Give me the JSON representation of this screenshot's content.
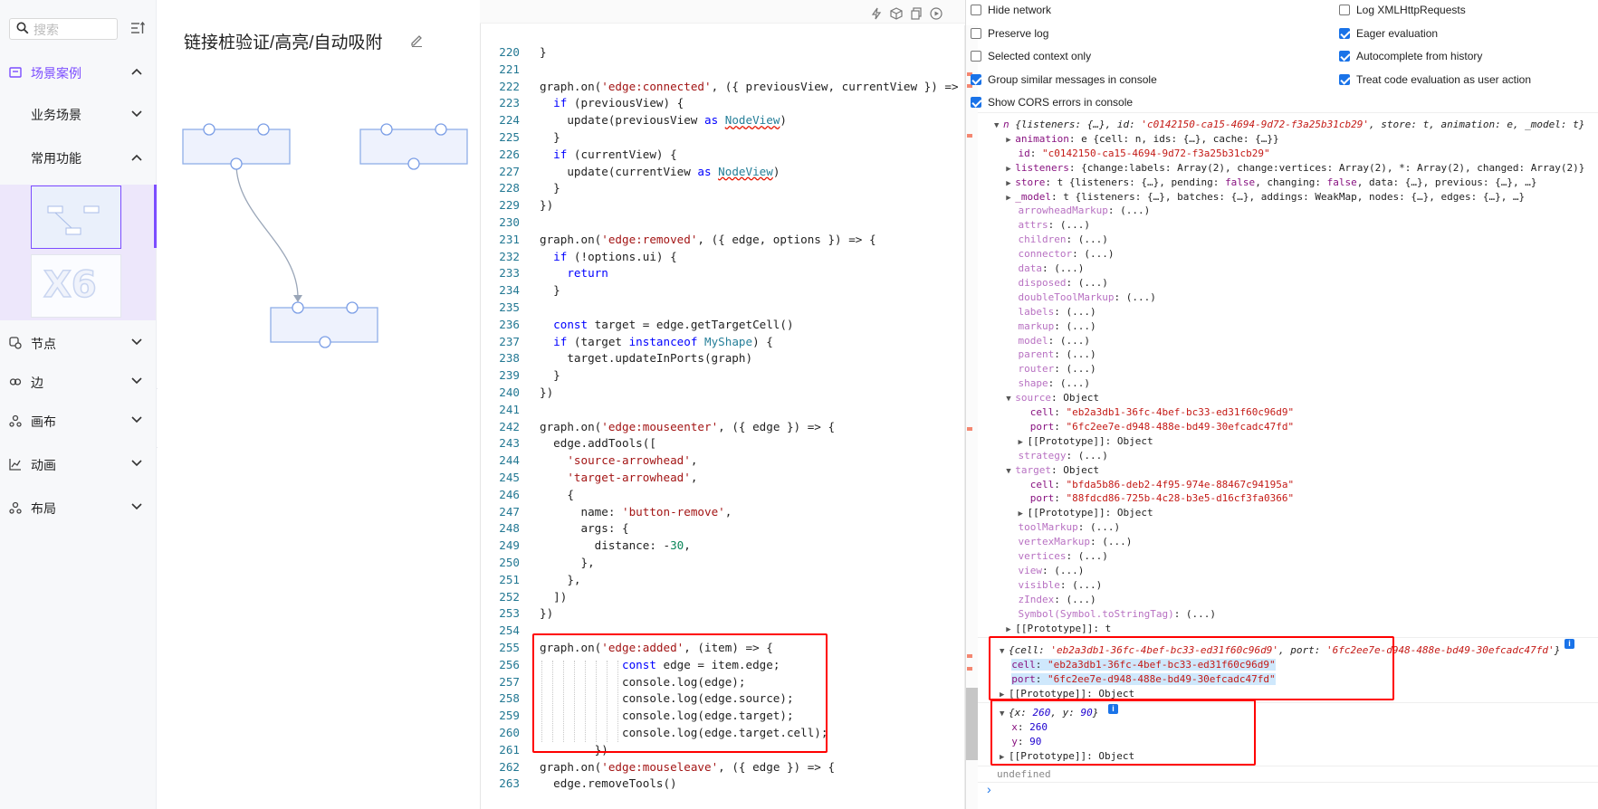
{
  "sidebar": {
    "search_placeholder": "搜索",
    "sections": [
      {
        "label": "场景案例",
        "active": true
      },
      {
        "label": "节点"
      },
      {
        "label": "边"
      },
      {
        "label": "画布"
      },
      {
        "label": "动画"
      },
      {
        "label": "布局"
      }
    ],
    "subsections": [
      {
        "label": "业务场景"
      },
      {
        "label": "常用功能",
        "active": true
      }
    ],
    "thumb2_text": "X6"
  },
  "preview": {
    "title": "链接桩验证/高亮/自动吸附"
  },
  "editor": {
    "lines": [
      {
        "n": "220",
        "html": "}"
      },
      {
        "n": "221",
        "html": ""
      },
      {
        "n": "222",
        "html": "graph.on(<span class='s'>'edge:connected'</span>, ({ previousView, currentView }) =>"
      },
      {
        "n": "223",
        "html": "  <span class='k'>if</span> (previousView) {"
      },
      {
        "n": "224",
        "html": "    update(previousView <span class='k'>as</span> <span class='t u'>NodeView</span>)"
      },
      {
        "n": "225",
        "html": "  }"
      },
      {
        "n": "226",
        "html": "  <span class='k'>if</span> (currentView) {"
      },
      {
        "n": "227",
        "html": "    update(currentView <span class='k'>as</span> <span class='t u'>NodeView</span>)"
      },
      {
        "n": "228",
        "html": "  }"
      },
      {
        "n": "229",
        "html": "})"
      },
      {
        "n": "230",
        "html": ""
      },
      {
        "n": "231",
        "html": "graph.on(<span class='s'>'edge:removed'</span>, ({ edge, options }) => {"
      },
      {
        "n": "232",
        "html": "  <span class='k'>if</span> (!options.ui) {"
      },
      {
        "n": "233",
        "html": "    <span class='k'>return</span>"
      },
      {
        "n": "234",
        "html": "  }"
      },
      {
        "n": "235",
        "html": ""
      },
      {
        "n": "236",
        "html": "  <span class='k'>const</span> target = edge.getTargetCell()"
      },
      {
        "n": "237",
        "html": "  <span class='k'>if</span> (target <span class='k'>instanceof</span> <span class='t'>MyShape</span>) {"
      },
      {
        "n": "238",
        "html": "    target.updateInPorts(graph)"
      },
      {
        "n": "239",
        "html": "  }"
      },
      {
        "n": "240",
        "html": "})"
      },
      {
        "n": "241",
        "html": ""
      },
      {
        "n": "242",
        "html": "graph.on(<span class='s'>'edge:mouseenter'</span>, ({ edge }) => {"
      },
      {
        "n": "243",
        "html": "  edge.addTools(["
      },
      {
        "n": "244",
        "html": "    <span class='s'>'source-arrowhead'</span>,"
      },
      {
        "n": "245",
        "html": "    <span class='s'>'target-arrowhead'</span>,"
      },
      {
        "n": "246",
        "html": "    {"
      },
      {
        "n": "247",
        "html": "      name: <span class='s'>'button-remove'</span>,"
      },
      {
        "n": "248",
        "html": "      args: {"
      },
      {
        "n": "249",
        "html": "        distance: -<span class='n'>30</span>,"
      },
      {
        "n": "250",
        "html": "      },"
      },
      {
        "n": "251",
        "html": "    },"
      },
      {
        "n": "252",
        "html": "  ])"
      },
      {
        "n": "253",
        "html": "})"
      },
      {
        "n": "254",
        "html": ""
      },
      {
        "n": "255",
        "html": "graph.on(<span class='s'>'edge:added'</span>, (item) => {"
      },
      {
        "n": "256",
        "html": "            <span class='k'>const</span> edge = item.edge;"
      },
      {
        "n": "257",
        "html": "            console.log(edge);"
      },
      {
        "n": "258",
        "html": "            console.log(edge.source);"
      },
      {
        "n": "259",
        "html": "            console.log(edge.target);"
      },
      {
        "n": "260",
        "html": "            console.log(edge.target.cell);"
      },
      {
        "n": "261",
        "html": "        })"
      },
      {
        "n": "262",
        "html": "graph.on(<span class='s'>'edge:mouseleave'</span>, ({ edge }) => {"
      },
      {
        "n": "263",
        "html": "  edge.removeTools()"
      }
    ]
  },
  "console": {
    "options_left": [
      {
        "label": "Hide network",
        "checked": false
      },
      {
        "label": "Preserve log",
        "checked": false
      },
      {
        "label": "Selected context only",
        "checked": false
      },
      {
        "label": "Group similar messages in console",
        "checked": true
      },
      {
        "label": "Show CORS errors in console",
        "checked": true
      }
    ],
    "options_right": [
      {
        "label": "Log XMLHttpRequests",
        "checked": false
      },
      {
        "label": "Eager evaluation",
        "checked": true
      },
      {
        "label": "Autocomplete from history",
        "checked": true
      },
      {
        "label": "Treat code evaluation as user action",
        "checked": true
      }
    ],
    "tree": [
      {
        "html": "<span class='arr'>▼</span><span class='it'><span class='key'>n</span> {listeners: {…}, id: <span class='str'>'c0142150-ca15-4694-9d72-f3a25b31cb29'</span>, store: t, animation: e, _model: t}</span>"
      },
      {
        "html": "&nbsp;&nbsp;<span class='arr'>▶</span><span class='key'>animation</span>: e {cell: n, ids: {…}, cache: {…}}"
      },
      {
        "html": "&nbsp;&nbsp;&nbsp;&nbsp;<span class='key'>id</span>: <span class='str'>\"c0142150-ca15-4694-9d72-f3a25b31cb29\"</span>"
      },
      {
        "html": "&nbsp;&nbsp;<span class='arr'>▶</span><span class='key'>listeners</span>: {change:labels: Array(2), change:vertices: Array(2), *: Array(2), changed: Array(2)}"
      },
      {
        "html": "&nbsp;&nbsp;<span class='arr'>▶</span><span class='key'>store</span>: t {listeners: {…}, pending: <span class='key'>false</span>, changing: <span class='key'>false</span>, data: {…}, previous: {…}, …}"
      },
      {
        "html": "&nbsp;&nbsp;<span class='arr'>▶</span><span class='key'>_model</span>: t {listeners: {…}, batches: {…}, addings: WeakMap, nodes: {…}, edges: {…}, …}"
      },
      {
        "html": "&nbsp;&nbsp;&nbsp;&nbsp;<span class='keyd'>arrowheadMarkup</span>: (...)"
      },
      {
        "html": "&nbsp;&nbsp;&nbsp;&nbsp;<span class='keyd'>attrs</span>: (...)"
      },
      {
        "html": "&nbsp;&nbsp;&nbsp;&nbsp;<span class='keyd'>children</span>: (...)"
      },
      {
        "html": "&nbsp;&nbsp;&nbsp;&nbsp;<span class='keyd'>connector</span>: (...)"
      },
      {
        "html": "&nbsp;&nbsp;&nbsp;&nbsp;<span class='keyd'>data</span>: (...)"
      },
      {
        "html": "&nbsp;&nbsp;&nbsp;&nbsp;<span class='keyd'>disposed</span>: (...)"
      },
      {
        "html": "&nbsp;&nbsp;&nbsp;&nbsp;<span class='keyd'>doubleToolMarkup</span>: (...)"
      },
      {
        "html": "&nbsp;&nbsp;&nbsp;&nbsp;<span class='keyd'>labels</span>: (...)"
      },
      {
        "html": "&nbsp;&nbsp;&nbsp;&nbsp;<span class='keyd'>markup</span>: (...)"
      },
      {
        "html": "&nbsp;&nbsp;&nbsp;&nbsp;<span class='keyd'>model</span>: (...)"
      },
      {
        "html": "&nbsp;&nbsp;&nbsp;&nbsp;<span class='keyd'>parent</span>: (...)"
      },
      {
        "html": "&nbsp;&nbsp;&nbsp;&nbsp;<span class='keyd'>router</span>: (...)"
      },
      {
        "html": "&nbsp;&nbsp;&nbsp;&nbsp;<span class='keyd'>shape</span>: (...)"
      },
      {
        "html": "&nbsp;&nbsp;<span class='arr'>▼</span><span class='keyd'>source</span>: Object"
      },
      {
        "html": "&nbsp;&nbsp;&nbsp;&nbsp;&nbsp;&nbsp;<span class='key'>cell</span>: <span class='str'>\"eb2a3db1-36fc-4bef-bc33-ed31f60c96d9\"</span>"
      },
      {
        "html": "&nbsp;&nbsp;&nbsp;&nbsp;&nbsp;&nbsp;<span class='key'>port</span>: <span class='str'>\"6fc2ee7e-d948-488e-bd49-30efcadc47fd\"</span>"
      },
      {
        "html": "&nbsp;&nbsp;&nbsp;&nbsp;<span class='arr'>▶</span>[[Prototype]]: Object"
      },
      {
        "html": "&nbsp;&nbsp;&nbsp;&nbsp;<span class='keyd'>strategy</span>: (...)"
      },
      {
        "html": "&nbsp;&nbsp;<span class='arr'>▼</span><span class='keyd'>target</span>: Object"
      },
      {
        "html": "&nbsp;&nbsp;&nbsp;&nbsp;&nbsp;&nbsp;<span class='key'>cell</span>: <span class='str'>\"bfda5b86-deb2-4f95-974e-88467c94195a\"</span>"
      },
      {
        "html": "&nbsp;&nbsp;&nbsp;&nbsp;&nbsp;&nbsp;<span class='key'>port</span>: <span class='str'>\"88fdcd86-725b-4c28-b3e5-d16cf3fa0366\"</span>"
      },
      {
        "html": "&nbsp;&nbsp;&nbsp;&nbsp;<span class='arr'>▶</span>[[Prototype]]: Object"
      },
      {
        "html": "&nbsp;&nbsp;&nbsp;&nbsp;<span class='keyd'>toolMarkup</span>: (...)"
      },
      {
        "html": "&nbsp;&nbsp;&nbsp;&nbsp;<span class='keyd'>vertexMarkup</span>: (...)"
      },
      {
        "html": "&nbsp;&nbsp;&nbsp;&nbsp;<span class='keyd'>vertices</span>: (...)"
      },
      {
        "html": "&nbsp;&nbsp;&nbsp;&nbsp;<span class='keyd'>view</span>: (...)"
      },
      {
        "html": "&nbsp;&nbsp;&nbsp;&nbsp;<span class='keyd'>visible</span>: (...)"
      },
      {
        "html": "&nbsp;&nbsp;&nbsp;&nbsp;<span class='keyd'>zIndex</span>: (...)"
      },
      {
        "html": "&nbsp;&nbsp;&nbsp;&nbsp;<span class='keyd'>Symbol(Symbol.toStringTag)</span>: (...)"
      },
      {
        "html": "&nbsp;&nbsp;<span class='arr'>▶</span>[[Prototype]]: t"
      }
    ],
    "source_log": [
      {
        "html": "<span class='arr'>▼</span><span class='it'>{cell: <span class='str'>'eb2a3db1-36fc-4bef-bc33-ed31f60c96d9'</span>, port: <span class='str'>'6fc2ee7e-d948-488e-bd49-30efcadc47fd'</span>}</span>"
      },
      {
        "html": "&nbsp;&nbsp;<span class='hl'><span class='key'>cell</span>: <span class='str'>\"eb2a3db1-36fc-4bef-bc33-ed31f60c96d9\"</span></span>"
      },
      {
        "html": "&nbsp;&nbsp;<span class='hl'><span class='key'>port</span>: <span class='str'>\"6fc2ee7e-d948-488e-bd49-30efcadc47fd\"</span></span>"
      },
      {
        "html": "<span class='arr'>▶</span>[[Prototype]]: Object"
      }
    ],
    "target_log": [
      {
        "html": "<span class='arr'>▼</span><span class='it'>{x: <span class='num'>260</span>, y: <span class='num'>90</span>}</span>"
      },
      {
        "html": "&nbsp;&nbsp;<span class='key'>x</span>: <span class='num'>260</span>"
      },
      {
        "html": "&nbsp;&nbsp;<span class='key'>y</span>: <span class='num'>90</span>"
      },
      {
        "html": "<span class='arr'>▶</span>[[Prototype]]: Object"
      }
    ],
    "undefined_text": "undefined",
    "prompt": "›"
  }
}
